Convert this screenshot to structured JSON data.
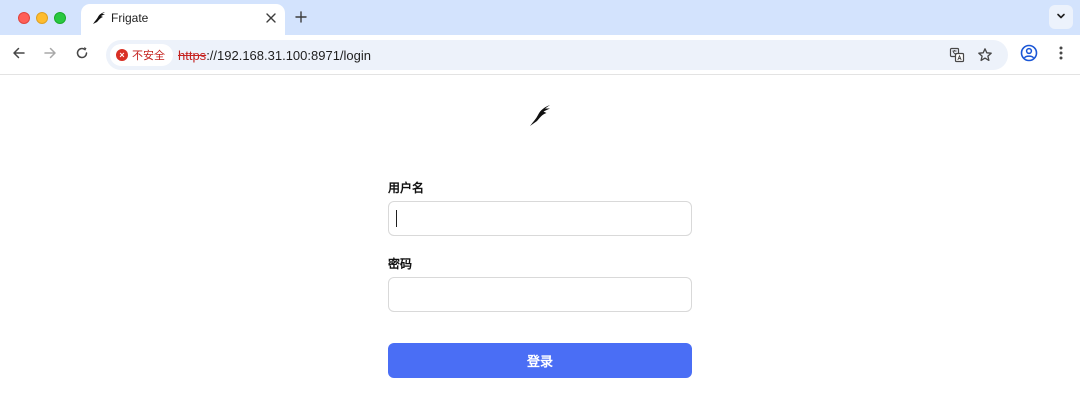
{
  "browser": {
    "tab": {
      "title": "Frigate"
    },
    "address": {
      "security_label": "不安全",
      "url_scheme": "https",
      "url_rest": "://192.168.31.100:8971/login"
    }
  },
  "login": {
    "username_label": "用户名",
    "username_value": "",
    "password_label": "密码",
    "password_value": "",
    "submit_label": "登录"
  },
  "colors": {
    "tabstrip_bg": "#d3e3fd",
    "insecure_red": "#c5221f",
    "primary_button": "#4a6ef5"
  },
  "icons": {
    "favicon": "frigate-bird-icon",
    "logo": "frigate-bird-logo",
    "back": "arrow-left-icon",
    "forward": "arrow-right-icon",
    "reload": "reload-icon",
    "translate": "translate-icon",
    "bookmark": "star-icon",
    "profile": "profile-icon",
    "menu": "kebab-menu-icon",
    "tab_search": "chevron-down-icon"
  }
}
